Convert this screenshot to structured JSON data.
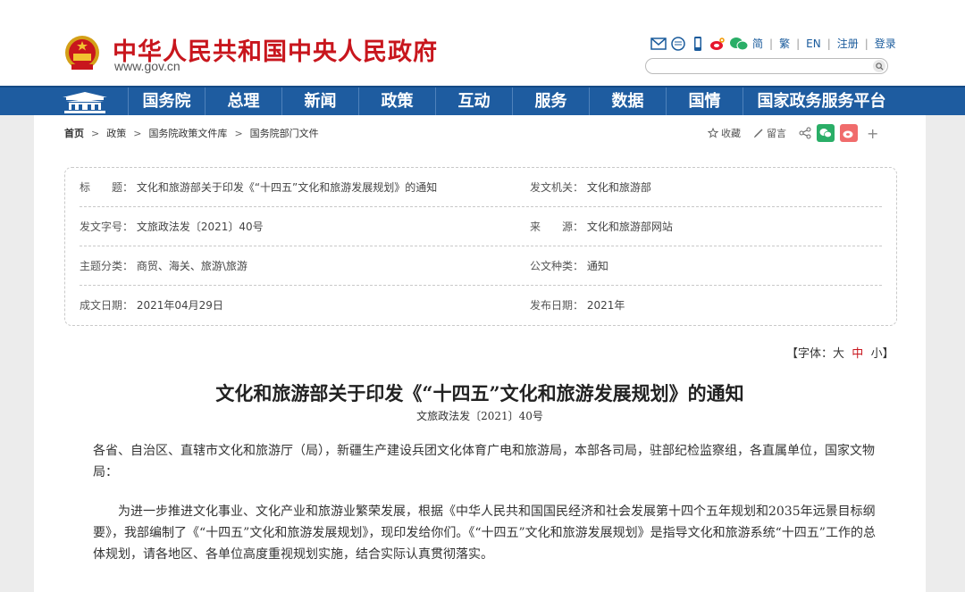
{
  "header": {
    "site_title": "中华人民共和国中央人民政府",
    "domain": "www.gov.cn",
    "links": [
      "简",
      "繁",
      "EN",
      "注册",
      "登录"
    ],
    "search_placeholder": ""
  },
  "nav": {
    "items": [
      "国务院",
      "总理",
      "新闻",
      "政策",
      "互动",
      "服务",
      "数据",
      "国情",
      "国家政务服务平台"
    ]
  },
  "breadcrumb": [
    "首页",
    "政策",
    "国务院政策文件库",
    "国务院部门文件"
  ],
  "share": {
    "fav": "收藏",
    "comment": "留言"
  },
  "info": {
    "title_label": "标　　题：",
    "title_value": "文化和旅游部关于印发《“十四五”文化和旅游发展规划》的通知",
    "issuer_label": "发文机关：",
    "issuer_value": "文化和旅游部",
    "docno_label": "发文字号：",
    "docno_value": "文旅政法发〔2021〕40号",
    "source_label": "来　　源：",
    "source_value": "文化和旅游部网站",
    "topic_label": "主题分类：",
    "topic_value": "商贸、海关、旅游\\旅游",
    "type_label": "公文种类：",
    "type_value": "通知",
    "date_label": "成文日期：",
    "date_value": "2021年04月29日",
    "pub_label": "发布日期：",
    "pub_value": "2021年"
  },
  "fontsize": {
    "prefix": "【字体：",
    "large": "大",
    "mid": "中",
    "small": "小",
    "suffix": "】"
  },
  "doc": {
    "title": "文化和旅游部关于印发《“十四五”文化和旅游发展规划》的通知",
    "number": "文旅政法发〔2021〕40号",
    "para1": "各省、自治区、直辖市文化和旅游厅（局），新疆生产建设兵团文化体育广电和旅游局，本部各司局，驻部纪检监察组，各直属单位，国家文物局：",
    "para2": "　　为进一步推进文化事业、文化产业和旅游业繁荣发展，根据《中华人民共和国国民经济和社会发展第十四个五年规划和2035年远景目标纲要》，我部编制了《“十四五”文化和旅游发展规划》，现印发给你们。《“十四五”文化和旅游发展规划》是指导文化和旅游系统“十四五”工作的总体规划，请各地区、各单位高度重视规划实施，结合实际认真贯彻落实。"
  },
  "colors": {
    "brand_red": "#c8161d",
    "nav_blue": "#1e5ca0"
  }
}
